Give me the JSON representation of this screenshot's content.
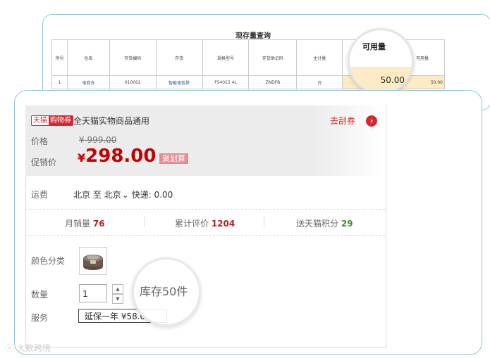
{
  "back": {
    "title": "现存量查询",
    "headers": [
      "序号",
      "仓库",
      "存货编码",
      "存货",
      "规格型号",
      "存货助记码",
      "主计量",
      "",
      "可用量"
    ],
    "row": [
      "1",
      "电商仓",
      "010002",
      "智能电饭煲",
      "FS4015 4L",
      "ZNDFB",
      "台",
      "",
      "50.00"
    ],
    "mag_label": "可用量",
    "mag_value": "50.00"
  },
  "product": {
    "tag_a": "天猫",
    "tag_b": "购物券",
    "coupon_text": "全天猫实物商品通用",
    "coupon_link": "去刮券",
    "price_label": "价格",
    "price_original": "¥ 999.00",
    "promo_label": "促销价",
    "currency": "¥",
    "promo_price": "298.00",
    "promo_badge": "聚划算",
    "ship_label": "运费",
    "ship_text": "北京 至 北京",
    "ship_method": "快递: 0.00",
    "stats": [
      {
        "label": "月销量",
        "value": "76"
      },
      {
        "label": "累计评价",
        "value": "1204"
      },
      {
        "label": "送天猫积分",
        "value": "29"
      }
    ],
    "color_label": "颜色分类",
    "qty_label": "数量",
    "qty_value": "1",
    "stock_text": "库存50件",
    "service_label": "服务",
    "service_value": "延保一年 ¥58.0"
  },
  "watermark": "大数跨境",
  "colors": {
    "accent_red": "#c40000",
    "tmall_red": "#d8282f",
    "border_teal": "#8ec5d6",
    "highlight": "#fcebc4"
  }
}
